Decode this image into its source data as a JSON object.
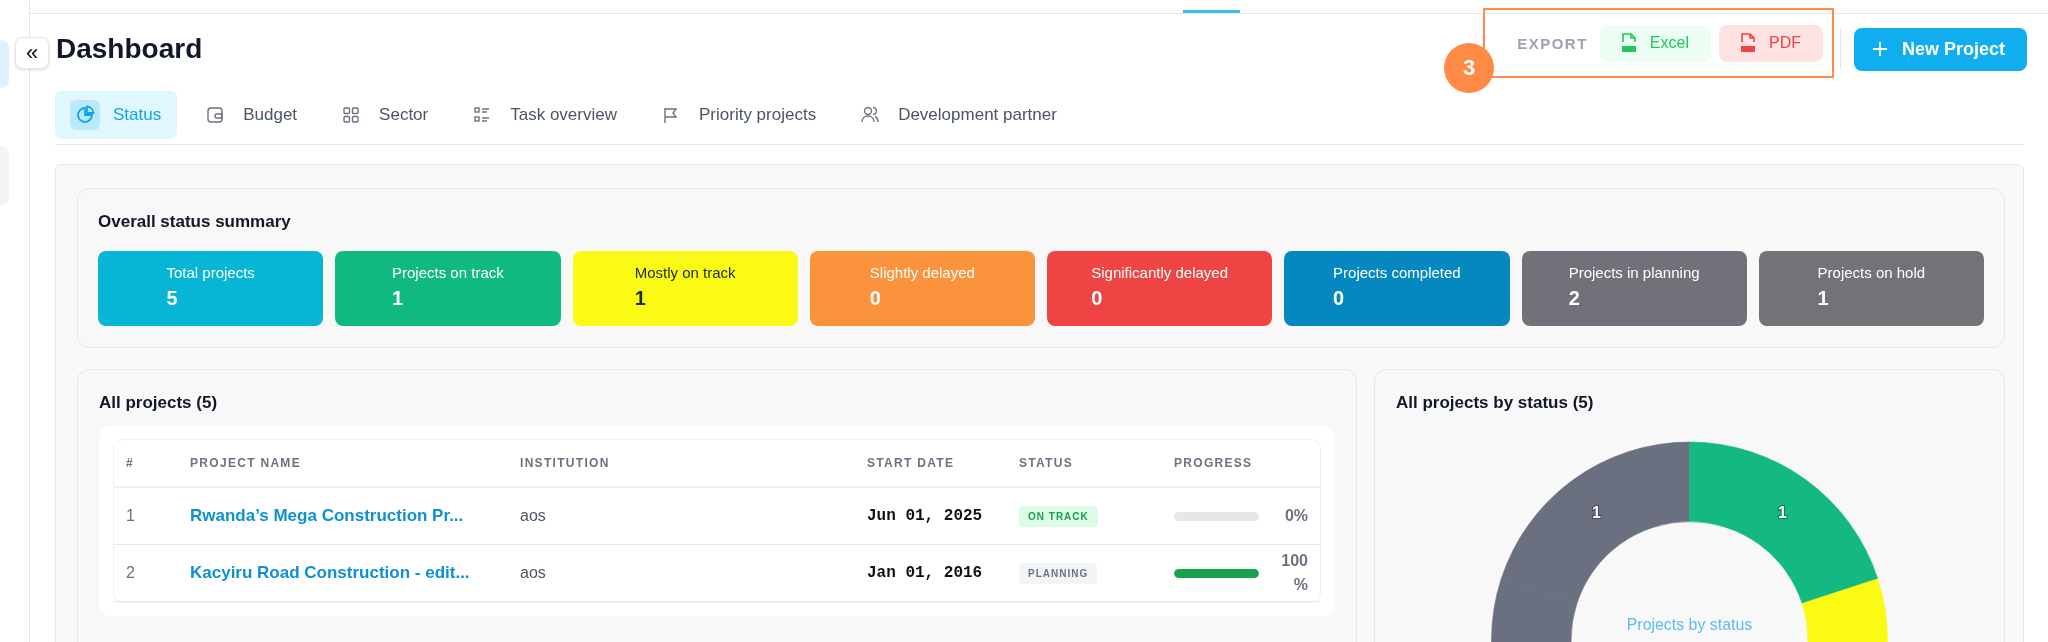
{
  "sidebar": {
    "collapse_button": "«"
  },
  "header": {
    "title": "Dashboard",
    "export": {
      "label": "EXPORT",
      "buttons": [
        {
          "label": "Excel",
          "kind": "excel"
        },
        {
          "label": "PDF",
          "kind": "pdf"
        }
      ]
    },
    "annotation": {
      "badge": "3"
    },
    "new_button": "New Project"
  },
  "tabs": [
    {
      "label": "Status",
      "selected": true
    },
    {
      "label": "Budget",
      "selected": false
    },
    {
      "label": "Sector",
      "selected": false
    },
    {
      "label": "Task overview",
      "selected": false
    },
    {
      "label": "Priority projects",
      "selected": false
    },
    {
      "label": "Development partner",
      "selected": false
    }
  ],
  "summary": {
    "title": "Overall status summary",
    "stats": [
      {
        "label": "Total projects",
        "value": "5",
        "color": "#06b6d4"
      },
      {
        "label": "Projects on track",
        "value": "1",
        "color": "#10b981"
      },
      {
        "label": "Mostly on track",
        "value": "1",
        "color": "#fafa14"
      },
      {
        "label": "Slightly delayed",
        "value": "0",
        "color": "#fb923c"
      },
      {
        "label": "Significantly delayed",
        "value": "0",
        "color": "#ef4444"
      },
      {
        "label": "Projects completed",
        "value": "0",
        "color": "#0588c0"
      },
      {
        "label": "Projects in planning",
        "value": "2",
        "color": "#71717a"
      },
      {
        "label": "Projects on hold",
        "value": "1",
        "color": "#727279"
      }
    ]
  },
  "projects": {
    "title": "All projects (5)",
    "columns": [
      "#",
      "PROJECT NAME",
      "INSTITUTION",
      "START DATE",
      "STATUS",
      "PROGRESS"
    ],
    "rows": [
      {
        "index": "1",
        "name": "Rwanda’s Mega Construction Pr...",
        "institution": "aos",
        "start_date": "Jun 01, 2025",
        "status": {
          "label": "ON TRACK",
          "kind": "on_track"
        },
        "level": 0,
        "percent": "0%"
      },
      {
        "index": "2",
        "name": "Kacyiru Road Construction - edit...",
        "institution": "aos",
        "start_date": "Jan 01, 2016",
        "status": {
          "label": "PLANNING",
          "kind": "planning"
        },
        "level": 1,
        "percent": "100%"
      }
    ]
  },
  "status_chart": {
    "title": "All projects by status (5)",
    "center_label": "Projects by status",
    "slices": [
      {
        "color": "#6b7081",
        "label": "1"
      },
      {
        "color": "#13b981",
        "label": "1"
      },
      {
        "color": "#fafa14"
      },
      {
        "color": "#6b7080"
      }
    ]
  }
}
